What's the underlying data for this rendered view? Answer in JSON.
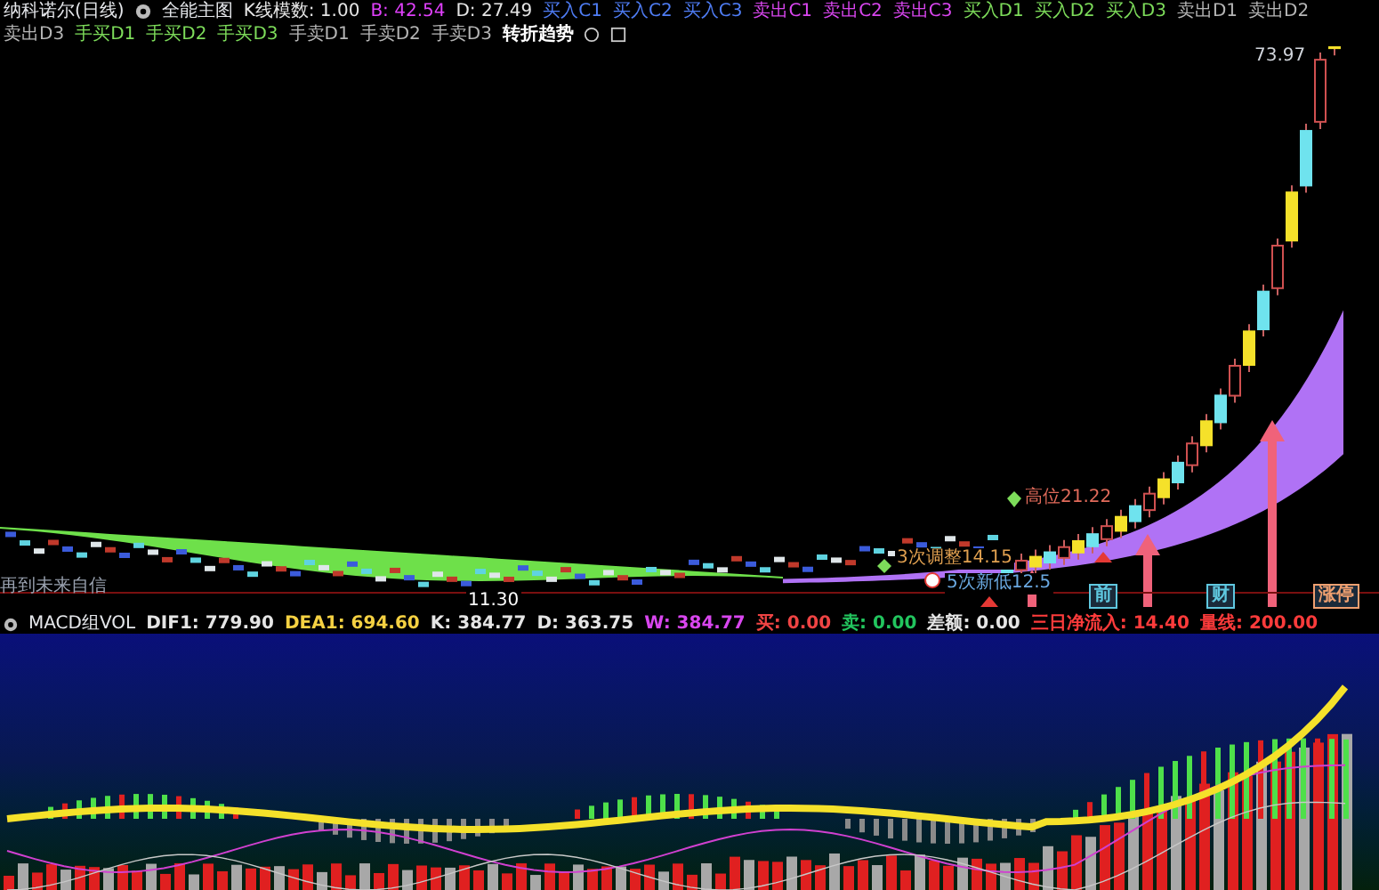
{
  "title_bar": {
    "stock": "纳科诺尔(日线)",
    "indicator": "全能主图",
    "readings": [
      {
        "label": "K线模数: 1.00",
        "color": "#e5e5e5"
      },
      {
        "label": "B: 42.54",
        "color": "#e040fb"
      },
      {
        "label": "D: 27.49",
        "color": "#e5e5e5"
      }
    ],
    "legend": [
      {
        "label": "买入C1",
        "color": "#4f7df5"
      },
      {
        "label": "买入C2",
        "color": "#4f7df5"
      },
      {
        "label": "买入C3",
        "color": "#4f7df5"
      },
      {
        "label": "卖出C1",
        "color": "#d946ef"
      },
      {
        "label": "卖出C2",
        "color": "#d946ef"
      },
      {
        "label": "卖出C3",
        "color": "#d946ef"
      },
      {
        "label": "买入D1",
        "color": "#7ddc5a"
      },
      {
        "label": "买入D2",
        "color": "#7ddc5a"
      },
      {
        "label": "买入D3",
        "color": "#7ddc5a"
      },
      {
        "label": "卖出D1",
        "color": "#b5b5b5"
      },
      {
        "label": "卖出D2",
        "color": "#b5b5b5"
      },
      {
        "label": "卖出D3",
        "color": "#b5b5b5"
      },
      {
        "label": "手买D1",
        "color": "#7ddc5a"
      },
      {
        "label": "手买D2",
        "color": "#7ddc5a"
      },
      {
        "label": "手买D3",
        "color": "#7ddc5a"
      },
      {
        "label": "手卖D1",
        "color": "#b5b5b5"
      },
      {
        "label": "手卖D2",
        "color": "#b5b5b5"
      },
      {
        "label": "手卖D3",
        "color": "#b5b5b5"
      }
    ],
    "trend": "转折趋势"
  },
  "main_chart": {
    "price_high": "73.97",
    "price_low": "11.30",
    "left_note": "再到未来自信",
    "annotations": [
      {
        "text": "高位21.22",
        "color": "#e06a5a"
      },
      {
        "text": "3次调整14.15",
        "color": "#e0a050"
      },
      {
        "text": "5次新低12.5",
        "color": "#6aa8e0"
      }
    ],
    "markers": [
      {
        "text": "前",
        "color": "#5fc8e0"
      },
      {
        "text": "财",
        "color": "#5fc8e0"
      },
      {
        "text": "涨停",
        "color": "#f0a070"
      }
    ]
  },
  "sub_chart": {
    "name": "MACD组VOL",
    "readings": [
      {
        "label": "DIF1: 779.90",
        "color": "#e5e5e5"
      },
      {
        "label": "DEA1: 694.60",
        "color": "#f5d142"
      },
      {
        "label": "K: 384.77",
        "color": "#e5e5e5"
      },
      {
        "label": "D: 363.75",
        "color": "#e5e5e5"
      },
      {
        "label": "W: 384.77",
        "color": "#d946ef"
      },
      {
        "label": "买: 0.00",
        "color": "#ef4444"
      },
      {
        "label": "卖: 0.00",
        "color": "#22c55e"
      },
      {
        "label": "差额: 0.00",
        "color": "#e5e5e5"
      },
      {
        "label": "三日净流入: 14.40",
        "color": "#ff3b3b"
      },
      {
        "label": "量线: 200.00",
        "color": "#ff3b3b"
      }
    ]
  }
}
